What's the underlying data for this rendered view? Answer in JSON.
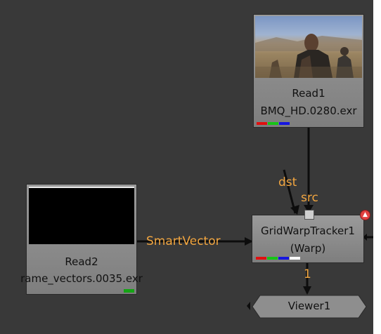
{
  "nodes": {
    "read1": {
      "name": "Read1",
      "file": "BMQ_HD.0280.exr"
    },
    "read2": {
      "name": "Read2",
      "file": "rame_vectors.0035.exr"
    },
    "gridwarp": {
      "name": "GridWarpTracker1",
      "class": "(Warp)"
    },
    "viewer": {
      "name": "Viewer1"
    }
  },
  "edges": {
    "dst": "dst",
    "src": "src",
    "smartvector": "SmartVector",
    "viewer_input": "1"
  },
  "colors": {
    "background": "#393939",
    "node_fill": "#8c8c8c",
    "edge_label": "#f2a640",
    "channel_red": "#e01010",
    "channel_green": "#16c416",
    "channel_blue": "#1515e0",
    "channel_white": "#ffffff",
    "warning": "#e04040"
  }
}
